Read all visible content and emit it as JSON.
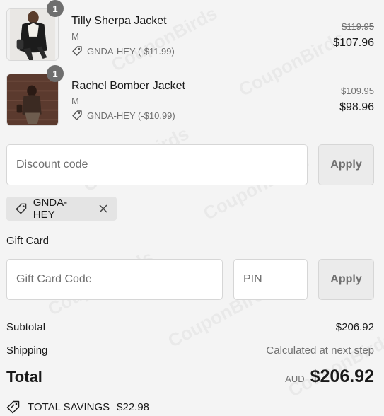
{
  "cart": {
    "items": [
      {
        "quantity": "1",
        "name": "Tilly Sherpa Jacket",
        "variant": "M",
        "discount": "GNDA-HEY (-$11.99)",
        "original_price": "$119.95",
        "price": "$107.96"
      },
      {
        "quantity": "1",
        "name": "Rachel Bomber Jacket",
        "variant": "M",
        "discount": "GNDA-HEY (-$10.99)",
        "original_price": "$109.95",
        "price": "$98.96"
      }
    ]
  },
  "discount": {
    "placeholder": "Discount code",
    "apply_label": "Apply",
    "applied_code": "GNDA-HEY"
  },
  "gift_card": {
    "heading": "Gift Card",
    "code_placeholder": "Gift Card Code",
    "pin_placeholder": "PIN",
    "apply_label": "Apply"
  },
  "summary": {
    "subtotal_label": "Subtotal",
    "subtotal_value": "$206.92",
    "shipping_label": "Shipping",
    "shipping_value": "Calculated at next step",
    "total_label": "Total",
    "currency": "AUD",
    "total_value": "$206.92",
    "savings_label": "TOTAL SAVINGS",
    "savings_value": "$22.98"
  },
  "watermark_text": "CouponBirds",
  "colors": {
    "background": "#f4f4f4",
    "text": "#1a1a1a",
    "muted": "#707070",
    "badge": "#6e6e6e",
    "button_bg": "#ebebeb",
    "chip_bg": "#e4e4e4"
  },
  "icons": {
    "tag": "tag-icon",
    "close": "close-icon",
    "savings": "savings-tag-icon"
  }
}
